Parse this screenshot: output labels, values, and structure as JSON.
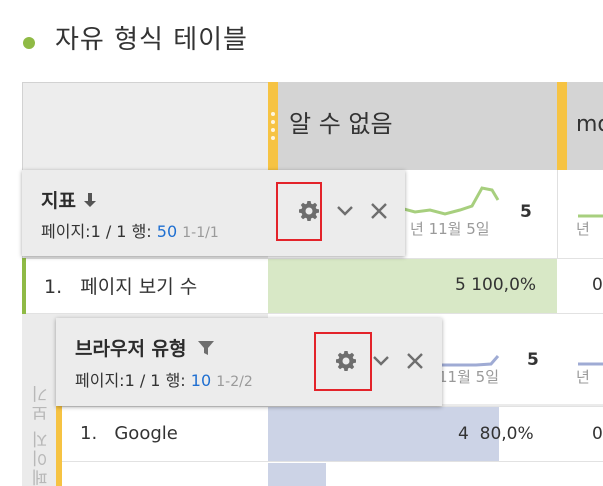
{
  "heading": {
    "title": "자유 형식 테이블",
    "bullet_color": "#8fba45"
  },
  "columns": [
    {
      "title": "알 수 없음",
      "total": "5",
      "date": "년 11월 5일",
      "total2": "5",
      "date2": "11월 5일"
    },
    {
      "title": "mo",
      "date": "년",
      "date2": "년"
    }
  ],
  "metric_panel": {
    "title": "지표",
    "sort_icon": "arrow-down-icon",
    "page_label": "페이지:",
    "page_value": "1 / 1",
    "rows_label": "행:",
    "rows_value": "50",
    "range": "1-1/1"
  },
  "dimension_panel": {
    "title": "브라우저 유형",
    "filter_icon": "filter-icon",
    "page_label": "페이지:",
    "page_value": "1 / 1",
    "rows_label": "행:",
    "rows_value": "10",
    "range": "1-2/2"
  },
  "metric_rows": [
    {
      "index": "1.",
      "label": "페이지 보기 수",
      "value": "5",
      "percent": "100,0%",
      "fill": 1.0,
      "truncated": "0"
    }
  ],
  "vertical_label": "페이지 보기 수",
  "dimension_rows": [
    {
      "index": "1.",
      "label": "Google",
      "value": "4",
      "percent": "80,0%",
      "fill": 0.8,
      "truncated": "0"
    },
    {
      "fill": 0.2
    }
  ],
  "colors": {
    "accent_green": "#8fba45",
    "accent_yellow": "#f6c343",
    "bar_green": "#d8e8c6",
    "bar_blue": "#ccd3e6",
    "highlight_red": "#e3232a",
    "link_blue": "#1f6fd1"
  }
}
